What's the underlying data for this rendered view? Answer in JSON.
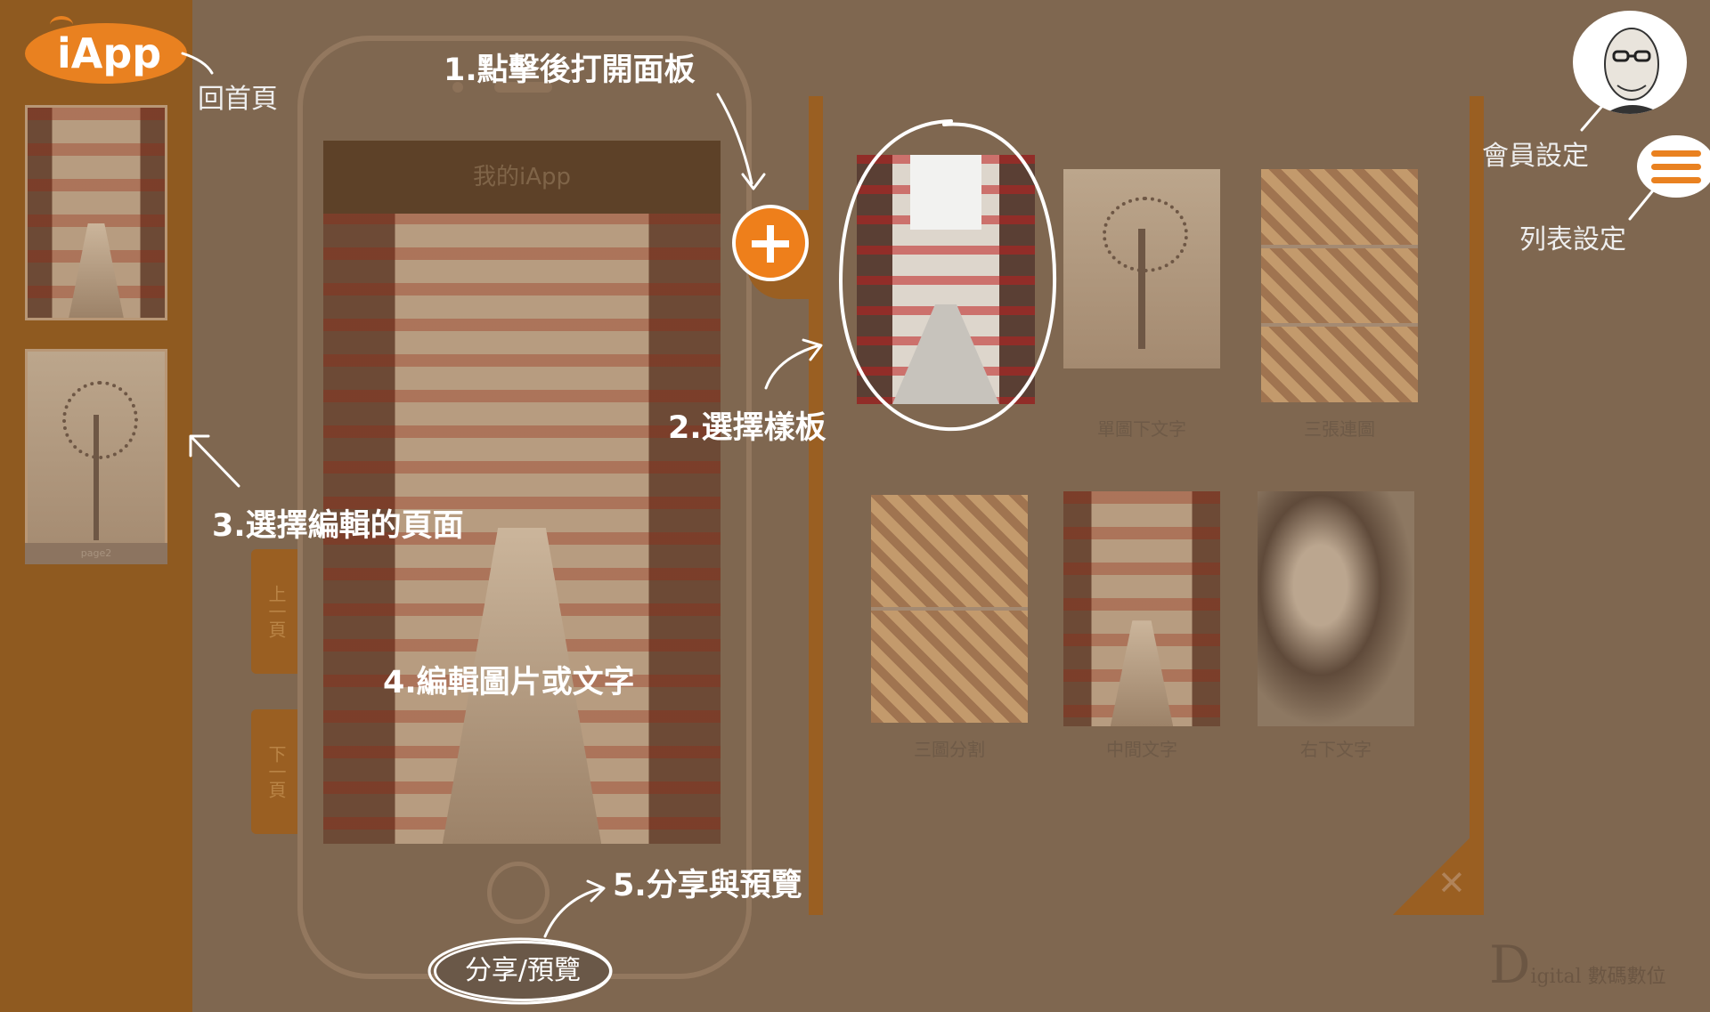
{
  "app": {
    "logo_text": "iApp",
    "phone_title": "我的iApp",
    "nav_prev": "上一頁",
    "nav_next": "下一頁",
    "page_caption": "page2",
    "brand": "D",
    "brand_suffix": "igital 數碼數位"
  },
  "templates": [
    {
      "label": ""
    },
    {
      "label": "單圖下文字"
    },
    {
      "label": "三張連圖"
    },
    {
      "label": "三圖分割"
    },
    {
      "label": "中間文字"
    },
    {
      "label": "右下文字"
    }
  ],
  "annotations": {
    "home": "回首頁",
    "step1": "1.點擊後打開面板",
    "step2": "2.選擇樣板",
    "step3": "3.選擇編輯的頁面",
    "step4": "4.編輯圖片或文字",
    "step5": "5.分享與預覽",
    "member": "會員設定",
    "list": "列表設定",
    "share_button": "分享/預覽"
  },
  "icons": {
    "plus": "plus-icon",
    "menu": "hamburger-menu-icon",
    "close": "close-icon",
    "avatar": "user-avatar-icon"
  },
  "colors": {
    "accent": "#e98120",
    "panel_orange": "#9a5f22",
    "overlay_dim": "#7f6750",
    "annotation_text": "#ffffff"
  }
}
